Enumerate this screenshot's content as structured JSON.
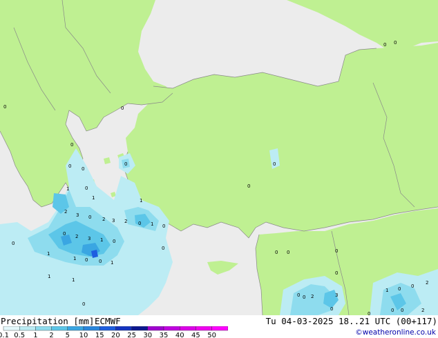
{
  "map": {
    "colors": {
      "land": "#bff092",
      "sea": "#ececec",
      "coast": "#888888",
      "precip_1": "#bcecf4",
      "precip_2": "#8edcee",
      "precip_3": "#5cc6e8",
      "precip_4": "#3aa6e2",
      "precip_5": "#1e5ee0"
    },
    "point_values": [
      "0",
      "0",
      "0",
      "0",
      "0",
      "0",
      "0",
      "1",
      "0",
      "1",
      "2",
      "3",
      "0",
      "2",
      "3",
      "2",
      "0",
      "1",
      "0",
      "1",
      "1",
      "0",
      "2",
      "3",
      "1",
      "0",
      "1",
      "0",
      "0",
      "1",
      "1",
      "1",
      "0",
      "0",
      "0",
      "0",
      "0",
      "0",
      "0",
      "0",
      "0",
      "0",
      "0",
      "0",
      "2",
      "3",
      "0",
      "0",
      "1",
      "0",
      "0",
      "2",
      "0",
      "0",
      "2"
    ]
  },
  "footer": {
    "title": "Precipitation [mm]",
    "model": "ECMWF",
    "validity": "Tu 04-03-2025 18..21 UTC (00+117)",
    "credit": "©weatheronline.co.uk",
    "scale_labels": [
      "0.1",
      "0.5",
      "1",
      "2",
      "5",
      "10",
      "15",
      "20",
      "25",
      "30",
      "35",
      "40",
      "45",
      "50"
    ],
    "scale_colors": [
      "#e4f8fb",
      "#bcecf4",
      "#8edcee",
      "#5cc6e8",
      "#3aa6e2",
      "#2a86dc",
      "#1e5ee0",
      "#1434c0",
      "#0c1890",
      "#a000d0",
      "#c000e0",
      "#dc00e8",
      "#f000f0",
      "#ff00ff"
    ]
  }
}
